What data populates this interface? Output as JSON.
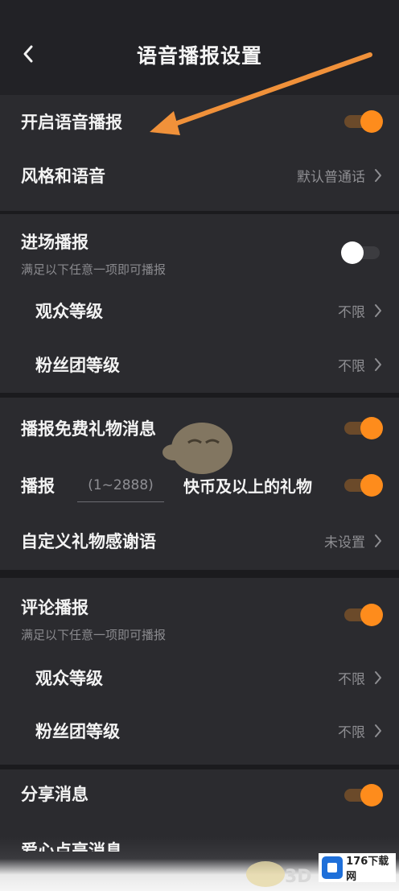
{
  "header": {
    "title": "语音播报设置"
  },
  "section1": {
    "voice_toggle_label": "开启语音播报",
    "voice_toggle_on": true,
    "style_label": "风格和语音",
    "style_value": "默认普通话"
  },
  "section2": {
    "entry_label": "进场播报",
    "entry_toggle_on": false,
    "entry_hint": "满足以下任意一项即可播报",
    "viewer_level_label": "观众等级",
    "viewer_level_value": "不限",
    "fan_level_label": "粉丝团等级",
    "fan_level_value": "不限"
  },
  "section3": {
    "free_gift_label": "播报免费礼物消息",
    "free_gift_on": true,
    "gift_prefix": "播报",
    "gift_input_placeholder": "(1~2888)",
    "gift_suffix": "快币及以上的礼物",
    "gift_on": true,
    "thanks_label": "自定义礼物感谢语",
    "thanks_value": "未设置"
  },
  "section4": {
    "comment_label": "评论播报",
    "comment_on": true,
    "comment_hint": "满足以下任意一项即可播报",
    "viewer_level_label": "观众等级",
    "viewer_level_value": "不限",
    "fan_level_label": "粉丝团等级",
    "fan_level_value": "不限"
  },
  "section5": {
    "share_label": "分享消息",
    "share_on": true,
    "next_label": "爱心点亮消息"
  },
  "watermark": {
    "site_text": "176下载网",
    "brand_3d": "3D"
  },
  "colors": {
    "accent": "#fe8c1c",
    "background": "#1b1b1e",
    "panel": "#2b2b2f",
    "annotation_arrow": "#f0913a"
  },
  "icons": [
    "back-arrow-icon",
    "chevron-right-icon",
    "annotation-arrow-icon"
  ]
}
